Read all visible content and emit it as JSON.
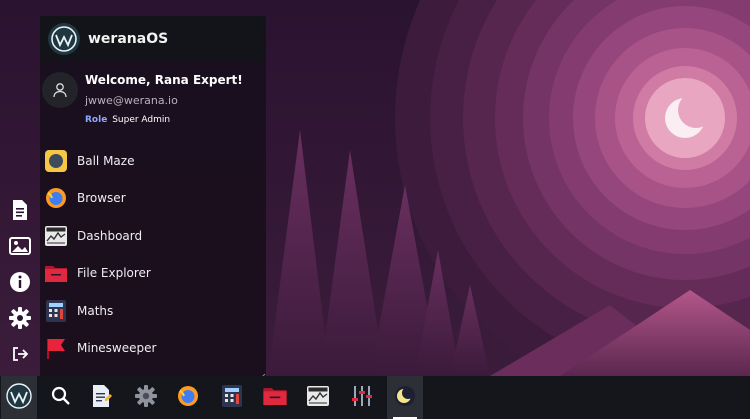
{
  "os": {
    "name": "weranaOS",
    "logo_icon": "werana-logo-icon"
  },
  "user": {
    "welcome": "Welcome, Rana Expert!",
    "email": "jwwe@werana.io",
    "role_label": "Role",
    "role_value": "Super Admin"
  },
  "apps": [
    {
      "label": "Ball Maze",
      "icon": "ball-maze-icon"
    },
    {
      "label": "Browser",
      "icon": "browser-icon"
    },
    {
      "label": "Dashboard",
      "icon": "dashboard-icon"
    },
    {
      "label": "File Explorer",
      "icon": "folder-icon"
    },
    {
      "label": "Maths",
      "icon": "calculator-icon"
    },
    {
      "label": "Minesweeper",
      "icon": "flag-icon"
    }
  ],
  "rail": [
    "document-icon",
    "image-icon",
    "info-icon",
    "settings-icon",
    "logout-icon"
  ],
  "taskbar": [
    "werana-logo-icon",
    "search-icon",
    "notes-icon",
    "settings-icon",
    "browser-icon",
    "calculator-icon",
    "folder-icon",
    "dashboard-icon",
    "equalizer-icon",
    "night-mode-icon"
  ],
  "colors": {
    "accent_blue": "#8fa7ff",
    "wallpaper_pink": "#d27aa8",
    "taskbar": "#14161b"
  }
}
